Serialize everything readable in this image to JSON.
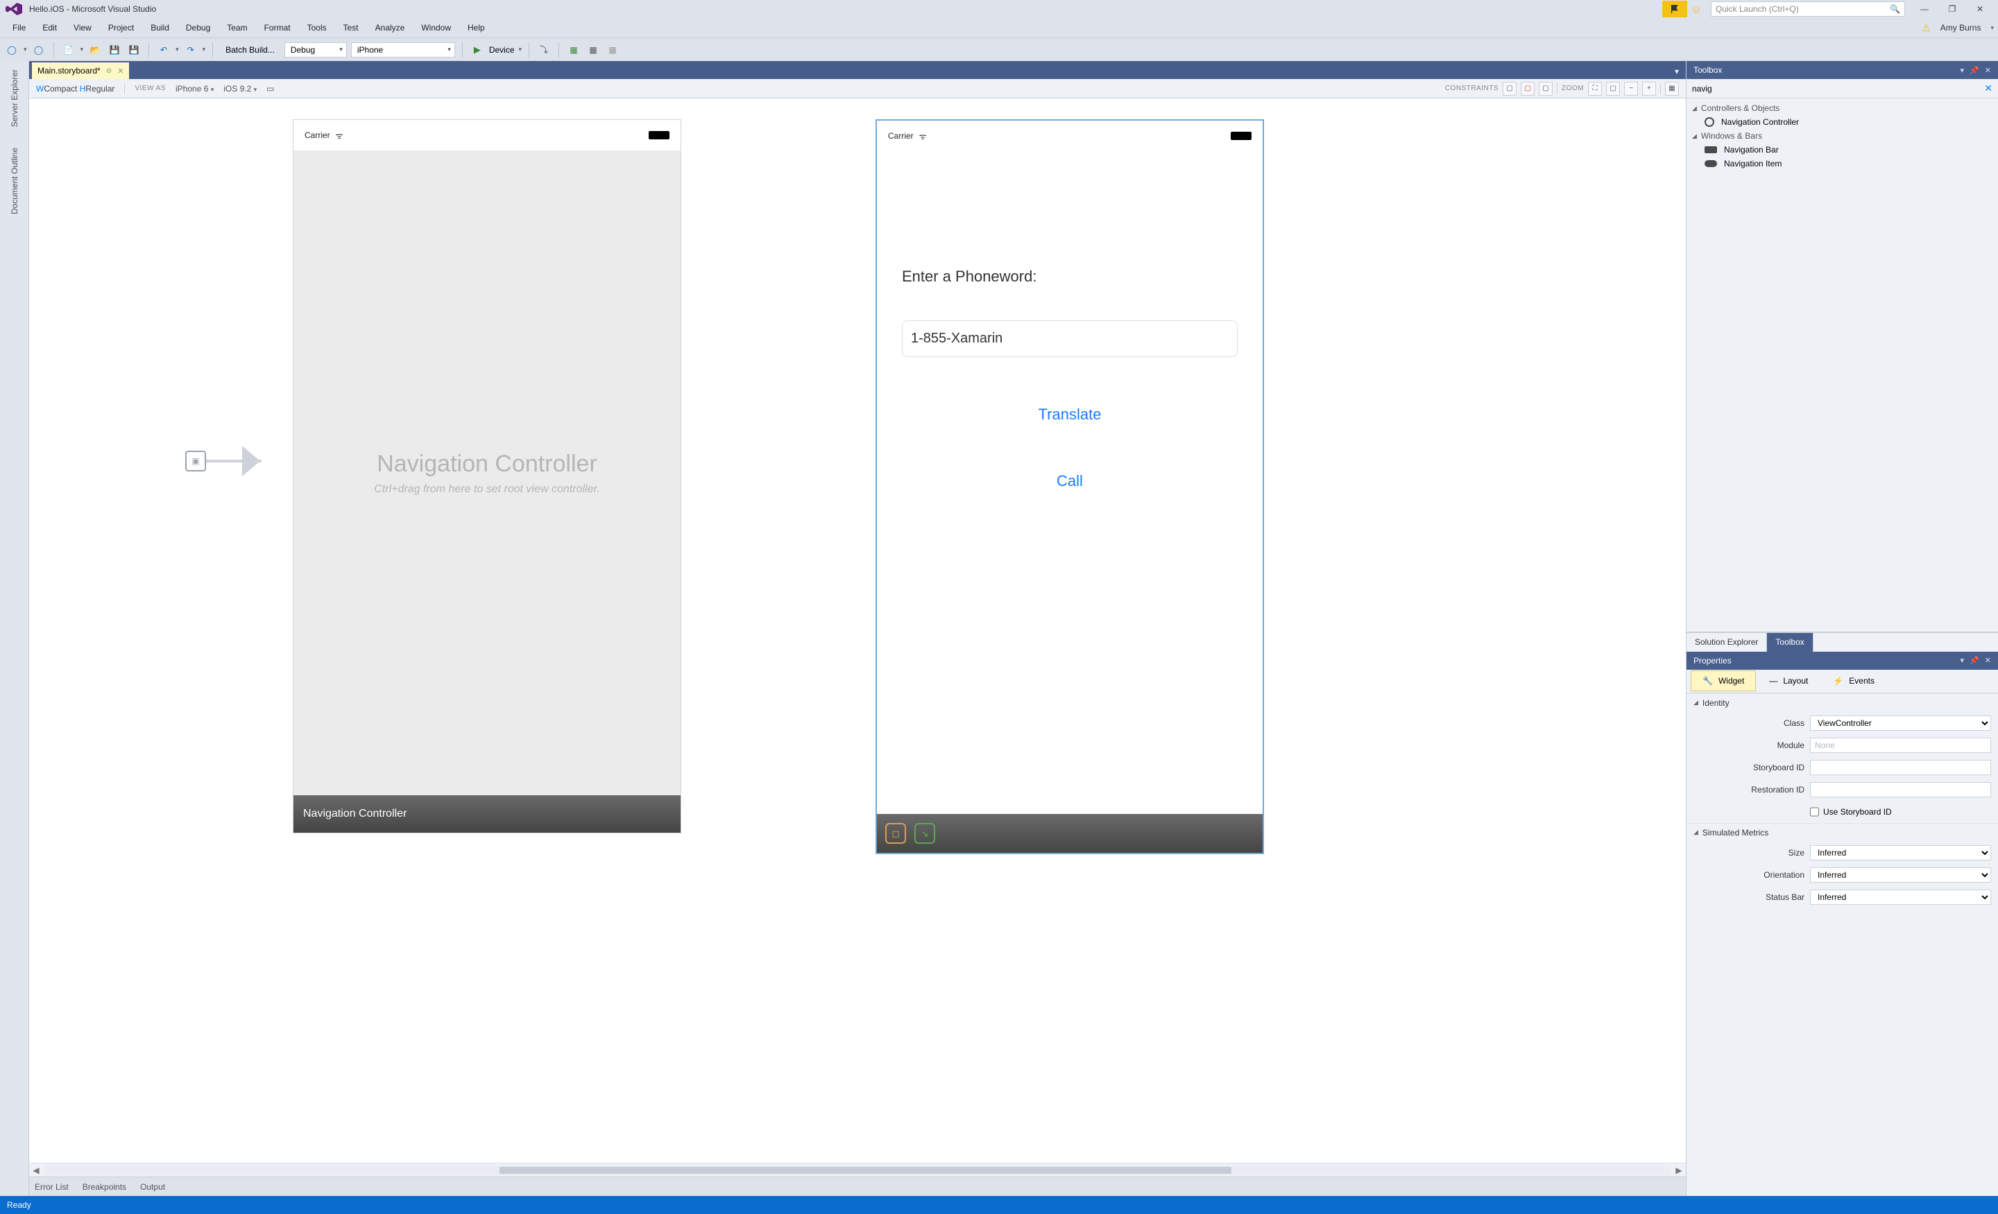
{
  "title_bar": {
    "app_title": "Hello.iOS - Microsoft Visual Studio",
    "quick_launch_placeholder": "Quick Launch (Ctrl+Q)"
  },
  "menu": {
    "items": [
      "File",
      "Edit",
      "View",
      "Project",
      "Build",
      "Debug",
      "Team",
      "Format",
      "Tools",
      "Test",
      "Analyze",
      "Window",
      "Help"
    ],
    "user": "Amy Burns"
  },
  "toolbar": {
    "batch_build": "Batch Build...",
    "config": "Debug",
    "device": "iPhone",
    "run_label": "Device"
  },
  "doc_tab": {
    "name": "Main.storyboard*"
  },
  "design_bar": {
    "w_char": "W",
    "compact": "Compact ",
    "h_char": "H",
    "regular": "Regular",
    "view_as": "VIEW AS",
    "device": "iPhone 6",
    "ios": "iOS 9.2",
    "constraints": "CONSTRAINTS",
    "zoom": "ZOOM"
  },
  "canvas": {
    "carrier": "Carrier",
    "nav_controller": {
      "title": "Navigation Controller",
      "subtitle": "Ctrl+drag from here to set root view controller.",
      "footer": "Navigation Controller"
    },
    "app_screen": {
      "label": "Enter a Phoneword:",
      "textfield_value": "1-855-Xamarin",
      "translate": "Translate",
      "call": "Call"
    }
  },
  "toolbox": {
    "title": "Toolbox",
    "search_value": "navig",
    "groups": [
      {
        "name": "Controllers & Objects",
        "items": [
          "Navigation Controller"
        ]
      },
      {
        "name": "Windows & Bars",
        "items": [
          "Navigation Bar",
          "Navigation Item"
        ]
      }
    ],
    "tabs": {
      "solution": "Solution Explorer",
      "toolbox": "Toolbox"
    }
  },
  "properties": {
    "title": "Properties",
    "tabs": {
      "widget": "Widget",
      "layout": "Layout",
      "events": "Events"
    },
    "identity": {
      "section": "Identity",
      "class_label": "Class",
      "class_value": "ViewController",
      "module_label": "Module",
      "module_placeholder": "None",
      "storyboard_label": "Storyboard ID",
      "storyboard_value": "",
      "restoration_label": "Restoration ID",
      "restoration_value": "",
      "use_sb_label": "Use Storyboard ID"
    },
    "simulated": {
      "section": "Simulated Metrics",
      "size_label": "Size",
      "size_value": "Inferred",
      "orientation_label": "Orientation",
      "orientation_value": "Inferred",
      "statusbar_label": "Status Bar",
      "statusbar_value": "Inferred"
    }
  },
  "bottom": {
    "error_list": "Error List",
    "breakpoints": "Breakpoints",
    "output": "Output"
  },
  "status": {
    "ready": "Ready"
  }
}
